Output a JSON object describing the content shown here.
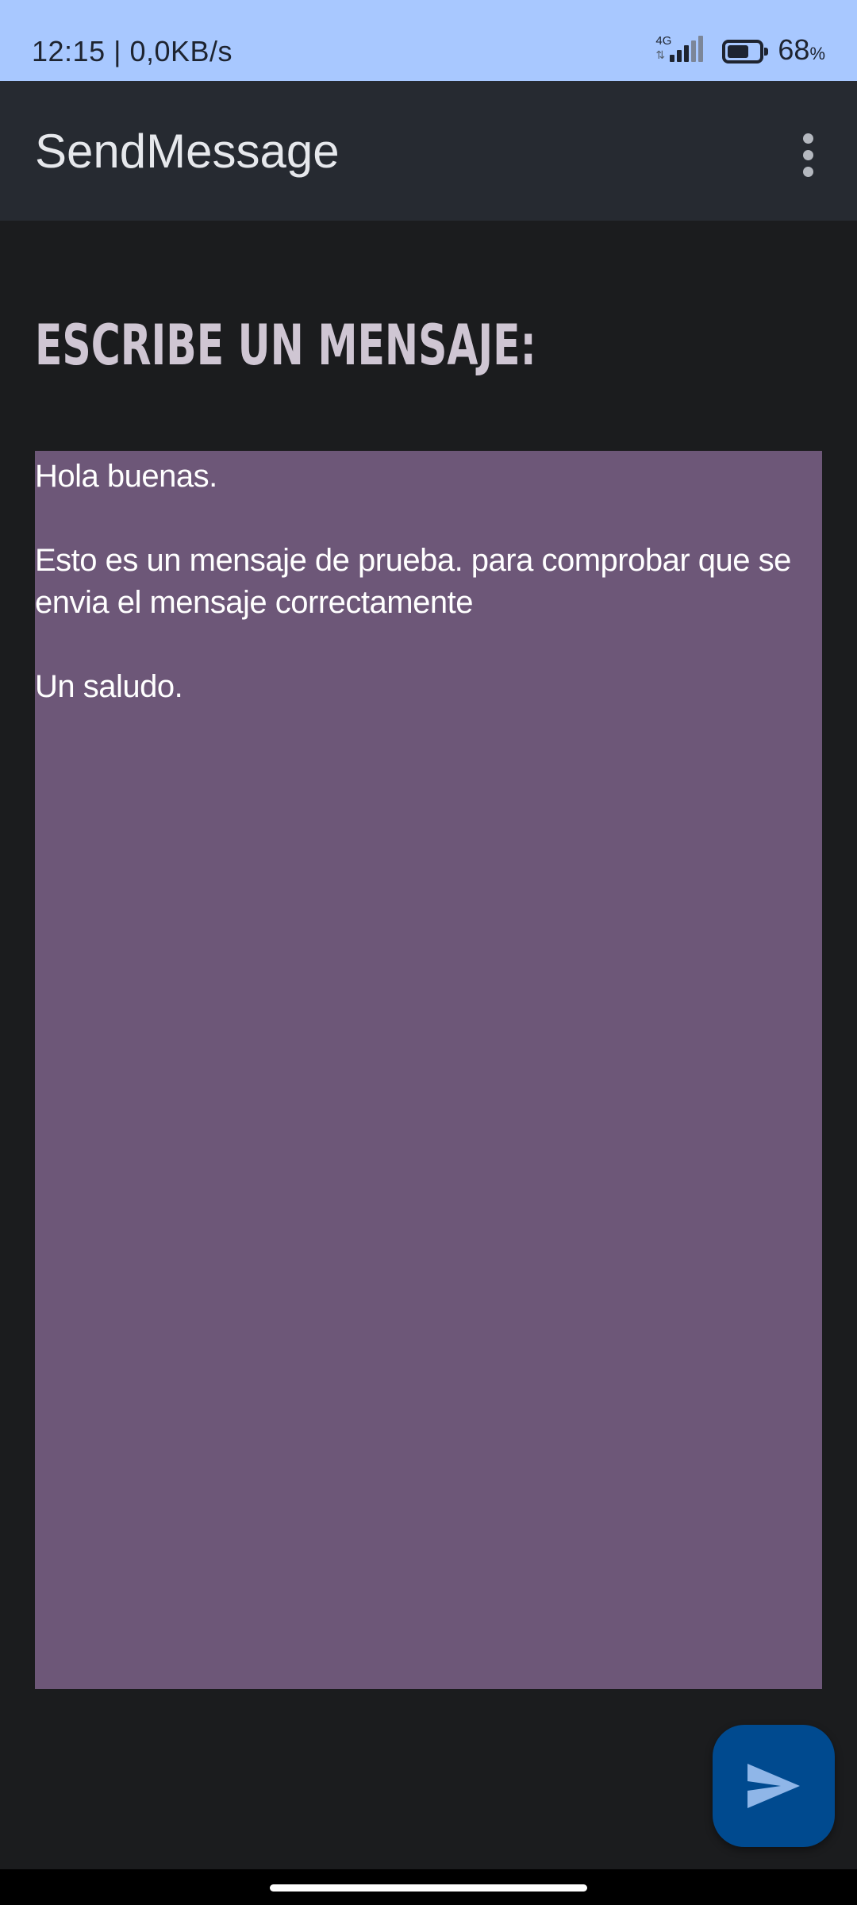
{
  "status_bar": {
    "time_speed": "12:15 | 0,0KB/s",
    "network_type": "4G",
    "signal_icon": "cell-signal-icon",
    "battery_icon": "battery-icon",
    "battery_level": 0.68,
    "battery_percent": "68",
    "battery_percent_sign": "%"
  },
  "app_bar": {
    "title": "SendMessage",
    "menu_icon": "more-vert-icon"
  },
  "main": {
    "heading": "ESCRIBE UN MENSAJE:",
    "message": "Hola buenas.\n\nEsto es un mensaje de prueba. para comprobar que se envia el mensaje correctamente\n\nUn saludo."
  },
  "fab": {
    "icon": "send-icon"
  },
  "colors": {
    "status_bar": "#a8c8ff",
    "app_bar": "#262a31",
    "background": "#1b1c1e",
    "message_box": "#6d5778",
    "heading": "#cfc6d3",
    "fab": "#004a8f",
    "send_icon": "#8fb6e8"
  }
}
